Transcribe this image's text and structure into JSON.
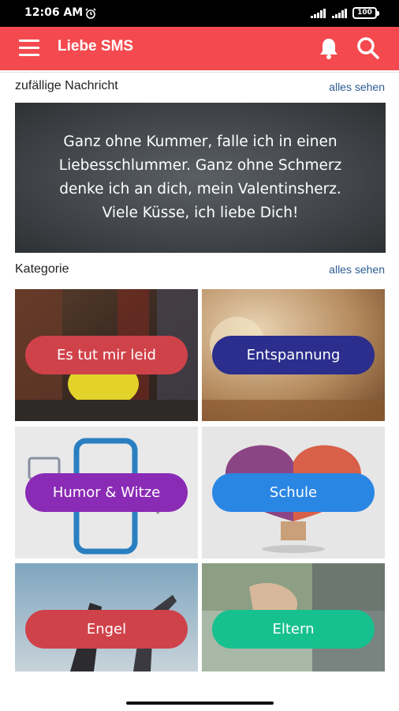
{
  "status_bar": {
    "time": "12:06 AM",
    "battery": "100"
  },
  "app_bar": {
    "title": "Liebe SMS"
  },
  "random_section": {
    "title": "zufällige Nachricht",
    "see_all": "alles sehen",
    "message_lines": [
      "Ganz ohne Kummer, falle ich in einen",
      "Liebesschlummer. Ganz ohne Schmerz",
      "denke ich an dich, mein Valentinsherz.",
      "Viele Küsse, ich liebe Dich!"
    ]
  },
  "category_section": {
    "title": "Kategorie",
    "see_all": "alles sehen",
    "items": [
      {
        "label": "Es tut mir leid",
        "color": "#d0424a"
      },
      {
        "label": "Entspannung",
        "color": "#2b2e8c"
      },
      {
        "label": "Humor & Witze",
        "color": "#8a2bb5"
      },
      {
        "label": "Schule",
        "color": "#2a86e3"
      },
      {
        "label": "Engel",
        "color": "#d0424a"
      },
      {
        "label": "Eltern",
        "color": "#17c08f"
      }
    ]
  },
  "colors": {
    "app_bar": "#f44a4f",
    "see_all_link": "#2b5c93"
  }
}
